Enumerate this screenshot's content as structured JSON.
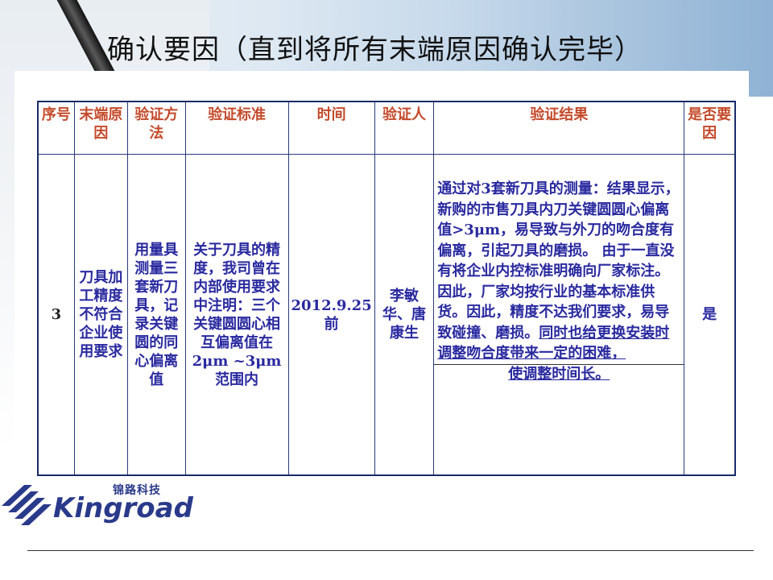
{
  "title": "确认要因（直到将所有末端原因确认完毕）",
  "table": {
    "headers": [
      "序号",
      "末端原因",
      "验证方法",
      "验证标准",
      "时间",
      "验证人",
      "验证结果",
      "是否要因"
    ],
    "row": {
      "no": "3",
      "cause": "刀具加工精度不符合企业使用要求",
      "method": "用量具测量三套新刀具，记录关键圆的同心偏离值",
      "standard": "关于刀具的精度，我司曾在内部使用要求中注明：三个关键圆圆心相互偏离值在2μm ~3μm范围内",
      "time": "2012.9.25前",
      "person": "李敏华、唐康生",
      "result_main": "通过对3套新刀具的测量：结果显示，新购的市售刀具内刀关键圆圆心偏离值>3μm，易导致与外刀的吻合度有偏离，引起刀具的磨损。 由于一直没有将企业内控标准明确向厂家标注。因此，厂家均按行业的基本标准供货。因此，精度不达我们要求，易导致碰撞、磨损。",
      "result_underlined": "同时也给更换安装时调整吻合度带来一定的困难，",
      "result_last": "使调整时间长。",
      "is_key": "是"
    }
  },
  "logo": {
    "cn": "锦路科技",
    "en": "Kingroad",
    "brand_color": "#2a3a8a"
  }
}
